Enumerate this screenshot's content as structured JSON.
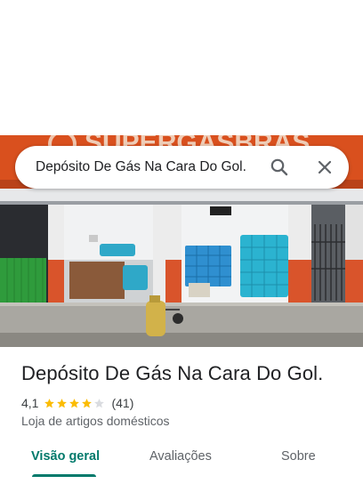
{
  "search": {
    "query": "Depósito De Gás Na Cara Do Gol."
  },
  "photo": {
    "sign_text": "SUPERGASBRAS",
    "description_icon": "storefront-photo"
  },
  "place": {
    "title": "Depósito De Gás Na Cara Do Gol.",
    "rating": "4,1",
    "stars_filled": 4,
    "stars_total": 5,
    "reviews": "(41)",
    "category": "Loja de artigos domésticos"
  },
  "tabs": [
    {
      "label": "Visão geral",
      "active": true
    },
    {
      "label": "Avaliações",
      "active": false
    },
    {
      "label": "Sobre",
      "active": false
    }
  ],
  "colors": {
    "accent": "#00796b",
    "star": "#fbbc04",
    "star_empty": "#dadce0"
  }
}
